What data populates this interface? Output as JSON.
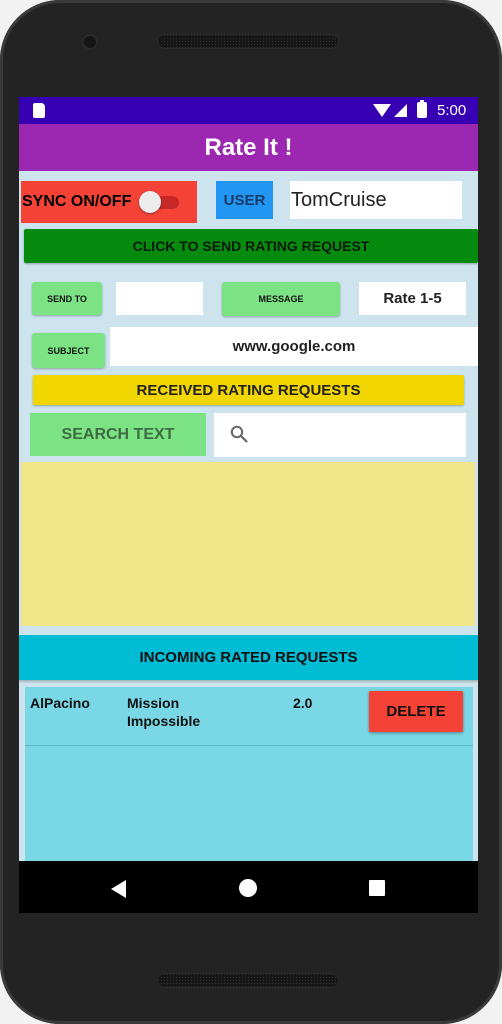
{
  "status_bar": {
    "time": "5:00",
    "icons": [
      "sd-card-icon",
      "wifi-icon",
      "signal-icon",
      "battery-charging-icon"
    ]
  },
  "app_bar": {
    "title": "Rate It !"
  },
  "sync": {
    "label": "SYNC ON/OFF",
    "enabled": false
  },
  "user": {
    "button_label": "USER",
    "value": "TomCruise"
  },
  "send_request": {
    "label": "CLICK TO SEND RATING REQUEST"
  },
  "compose": {
    "send_to_label": "SEND TO",
    "send_to_value": "",
    "message_label": "MESSAGE",
    "message_value": "Rate 1-5",
    "subject_label": "SUBJECT",
    "subject_value": "www.google.com"
  },
  "received": {
    "header": "RECEIVED RATING REQUESTS",
    "search_button_label": "SEARCH TEXT",
    "search_value": "",
    "items": []
  },
  "incoming": {
    "header": "INCOMING RATED REQUESTS",
    "rows": [
      {
        "user": "AlPacino",
        "movie": "Mission Impossible",
        "rating": "2.0",
        "delete_label": "DELETE"
      }
    ]
  },
  "colors": {
    "status_bar": "#3700b3",
    "app_bar": "#9c27b0",
    "screen_bg": "#cde4ee",
    "sync_bg": "#f44336",
    "user_btn": "#2196f3",
    "send_btn": "#078b0f",
    "green_btn": "#7be383",
    "received_header": "#f2d600",
    "received_list": "#f1e58a",
    "incoming_header": "#00bcd4",
    "incoming_list": "#7ad7e5",
    "delete_btn": "#f44336"
  }
}
